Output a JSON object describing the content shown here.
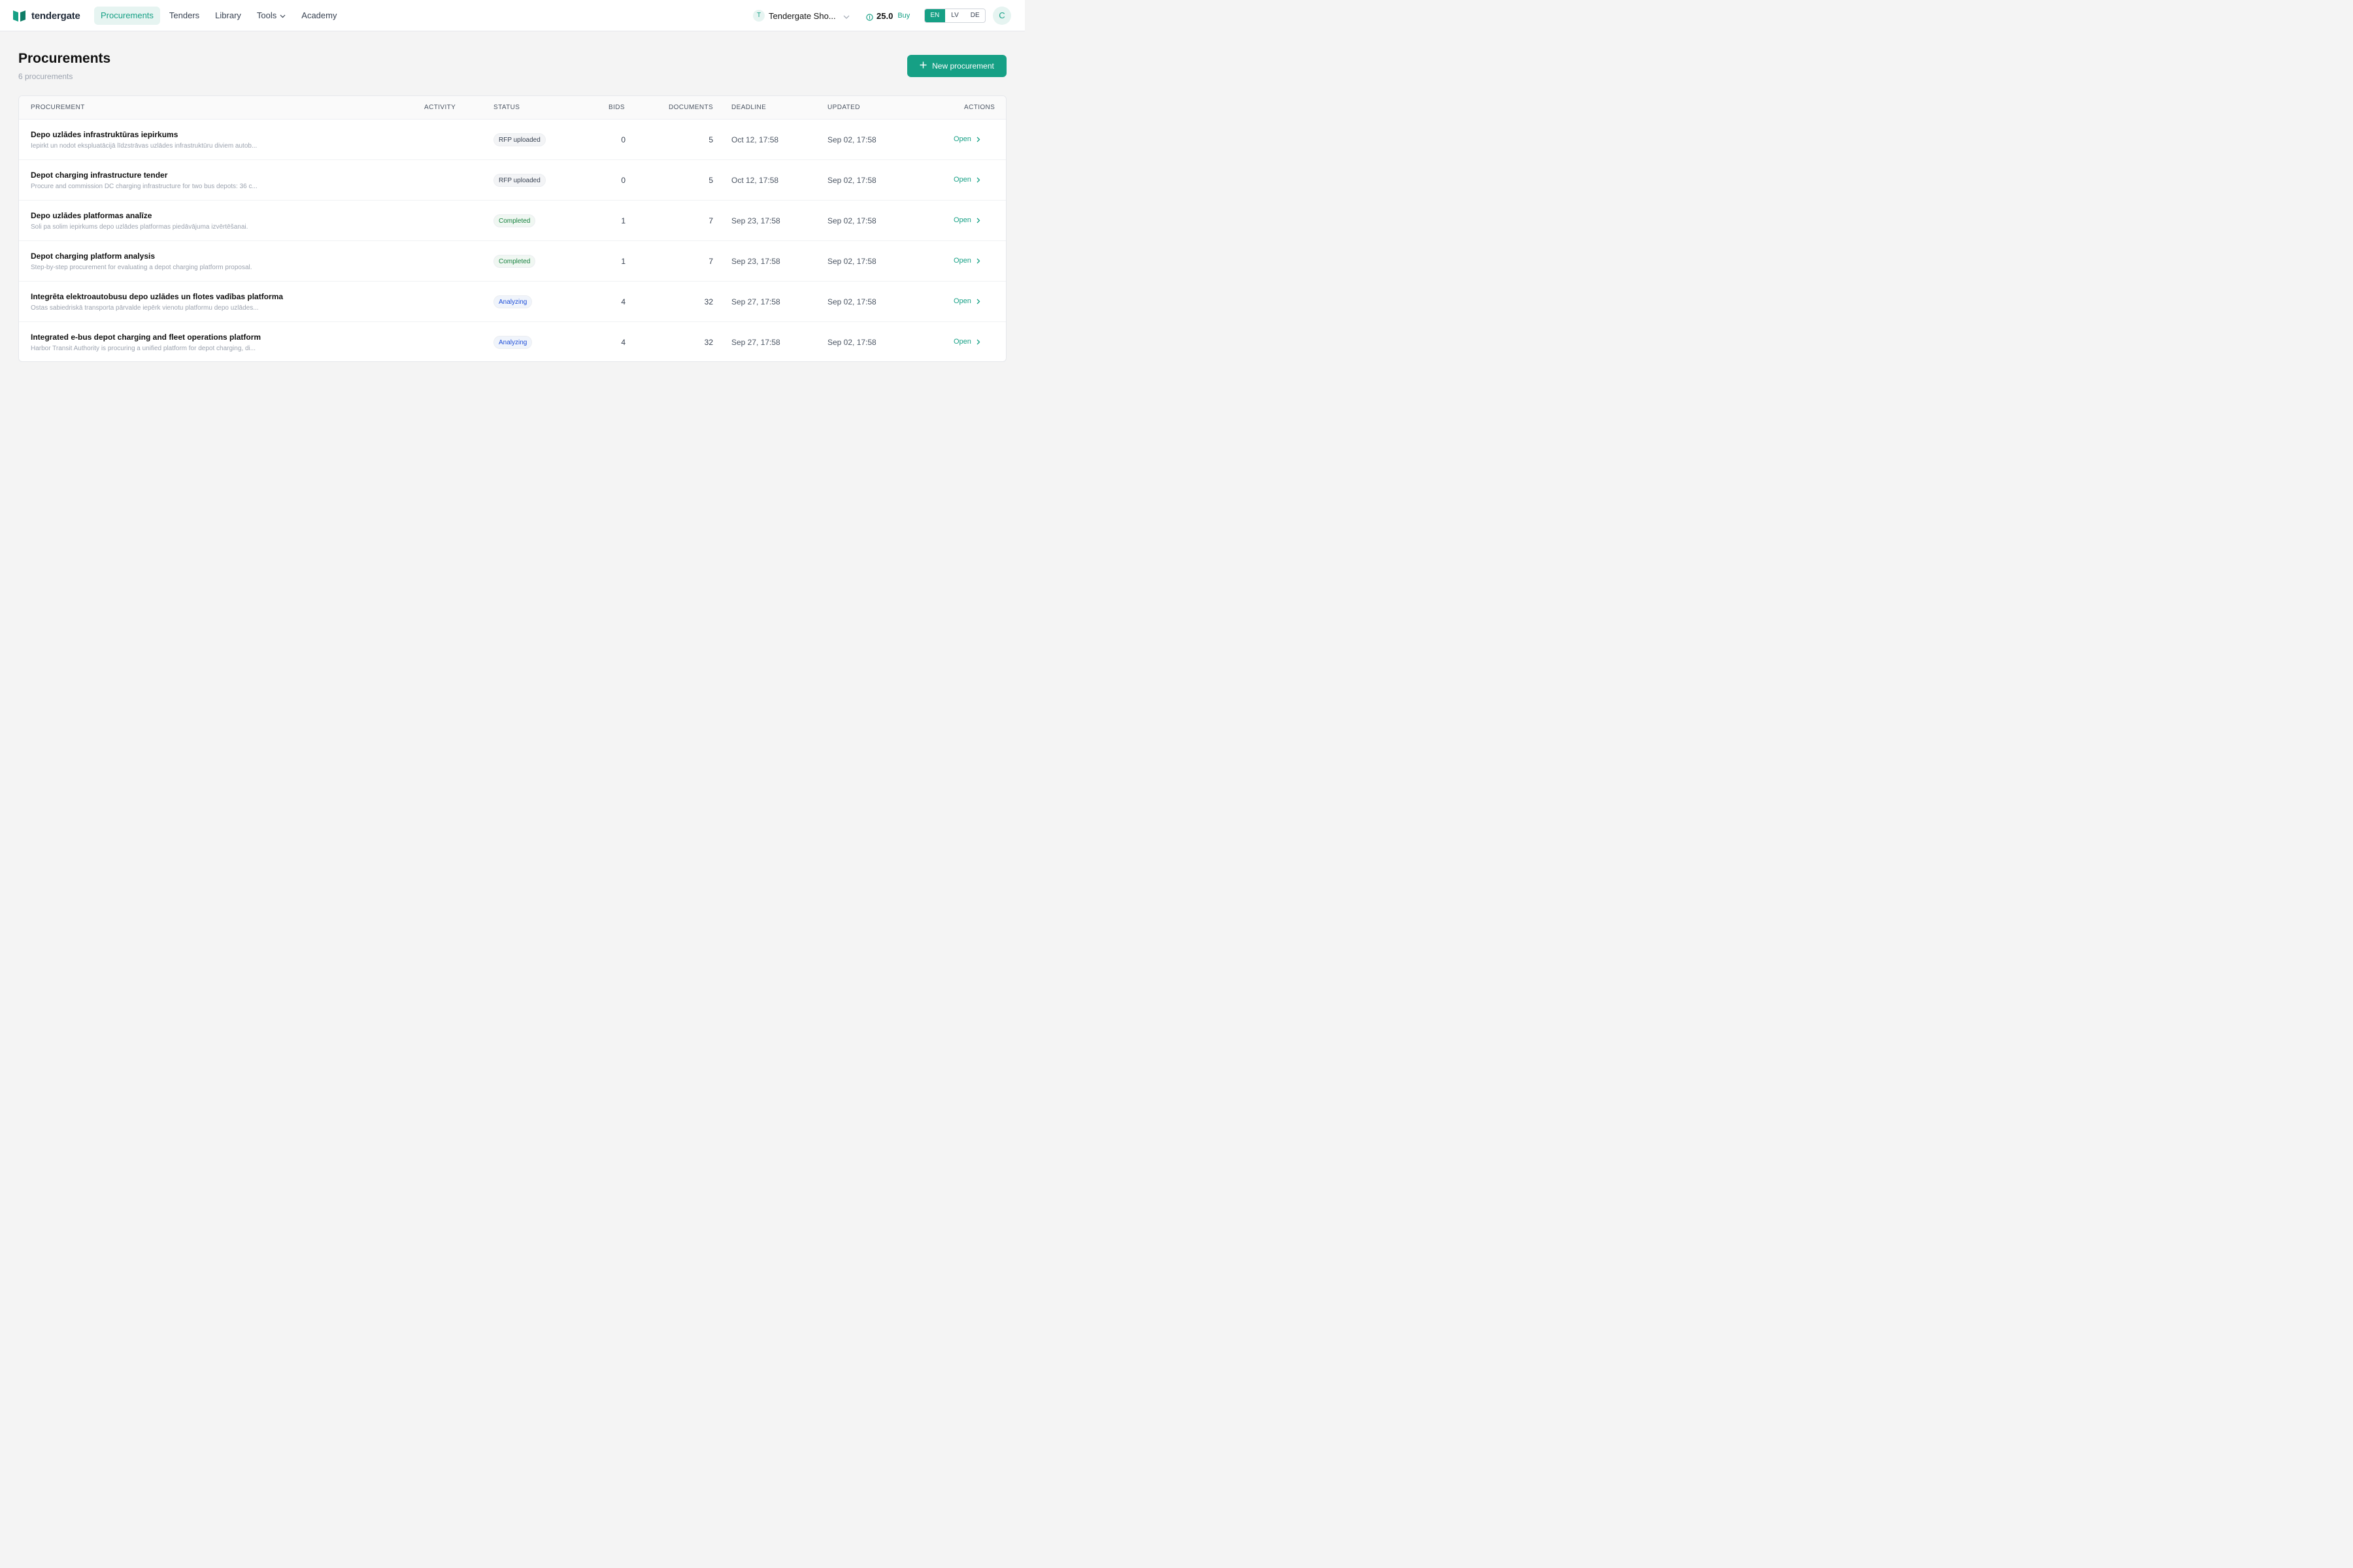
{
  "brand": {
    "name": "tendergate",
    "accent": "#16a085"
  },
  "nav": [
    {
      "label": "Procurements",
      "active": true
    },
    {
      "label": "Tenders"
    },
    {
      "label": "Library"
    },
    {
      "label": "Tools",
      "has_dropdown": true
    },
    {
      "label": "Academy"
    }
  ],
  "org": {
    "avatar": "T",
    "name": "Tendergate Sho..."
  },
  "credits": {
    "value": "25.0",
    "buy_label": "Buy",
    "icon": "coin-icon"
  },
  "languages": [
    {
      "code": "EN",
      "active": true
    },
    {
      "code": "LV"
    },
    {
      "code": "DE"
    }
  ],
  "user": {
    "initial": "C"
  },
  "page": {
    "title": "Procurements",
    "subtitle": "6 procurements",
    "new_button": "New procurement"
  },
  "table": {
    "columns": {
      "procurement": "PROCUREMENT",
      "activity": "ACTIVITY",
      "status": "STATUS",
      "bids": "BIDS",
      "documents": "DOCUMENTS",
      "deadline": "DEADLINE",
      "updated": "UPDATED",
      "actions": "ACTIONS"
    },
    "rows": [
      {
        "title": "Depo uzlādes infrastruktūras iepirkums",
        "description": "Iepirkt un nodot ekspluatācijā līdzstrāvas uzlādes infrastruktūru diviem autob...",
        "status": "RFP uploaded",
        "bids": "0",
        "documents": "5",
        "deadline": "Oct 12, 17:58",
        "updated": "Sep 02, 17:58",
        "action": "Open"
      },
      {
        "title": "Depot charging infrastructure tender",
        "description": "Procure and commission DC charging infrastructure for two bus depots: 36 c...",
        "status": "RFP uploaded",
        "bids": "0",
        "documents": "5",
        "deadline": "Oct 12, 17:58",
        "updated": "Sep 02, 17:58",
        "action": "Open"
      },
      {
        "title": "Depo uzlādes platformas analīze",
        "description": "Soli pa solim iepirkums depo uzlādes platformas piedāvājuma izvērtēšanai.",
        "status": "Completed",
        "bids": "1",
        "documents": "7",
        "deadline": "Sep 23, 17:58",
        "updated": "Sep 02, 17:58",
        "action": "Open"
      },
      {
        "title": "Depot charging platform analysis",
        "description": "Step-by-step procurement for evaluating a depot charging platform proposal.",
        "status": "Completed",
        "bids": "1",
        "documents": "7",
        "deadline": "Sep 23, 17:58",
        "updated": "Sep 02, 17:58",
        "action": "Open"
      },
      {
        "title": "Integrēta elektroautobusu depo uzlādes un flotes vadības platforma",
        "description": "Ostas sabiedriskā transporta pārvalde iepērk vienotu platformu depo uzlādes...",
        "status": "Analyzing",
        "bids": "4",
        "documents": "32",
        "deadline": "Sep 27, 17:58",
        "updated": "Sep 02, 17:58",
        "action": "Open"
      },
      {
        "title": "Integrated e-bus depot charging and fleet operations platform",
        "description": "Harbor Transit Authority is procuring a unified platform for depot charging, di...",
        "status": "Analyzing",
        "bids": "4",
        "documents": "32",
        "deadline": "Sep 27, 17:58",
        "updated": "Sep 02, 17:58",
        "action": "Open"
      }
    ]
  }
}
